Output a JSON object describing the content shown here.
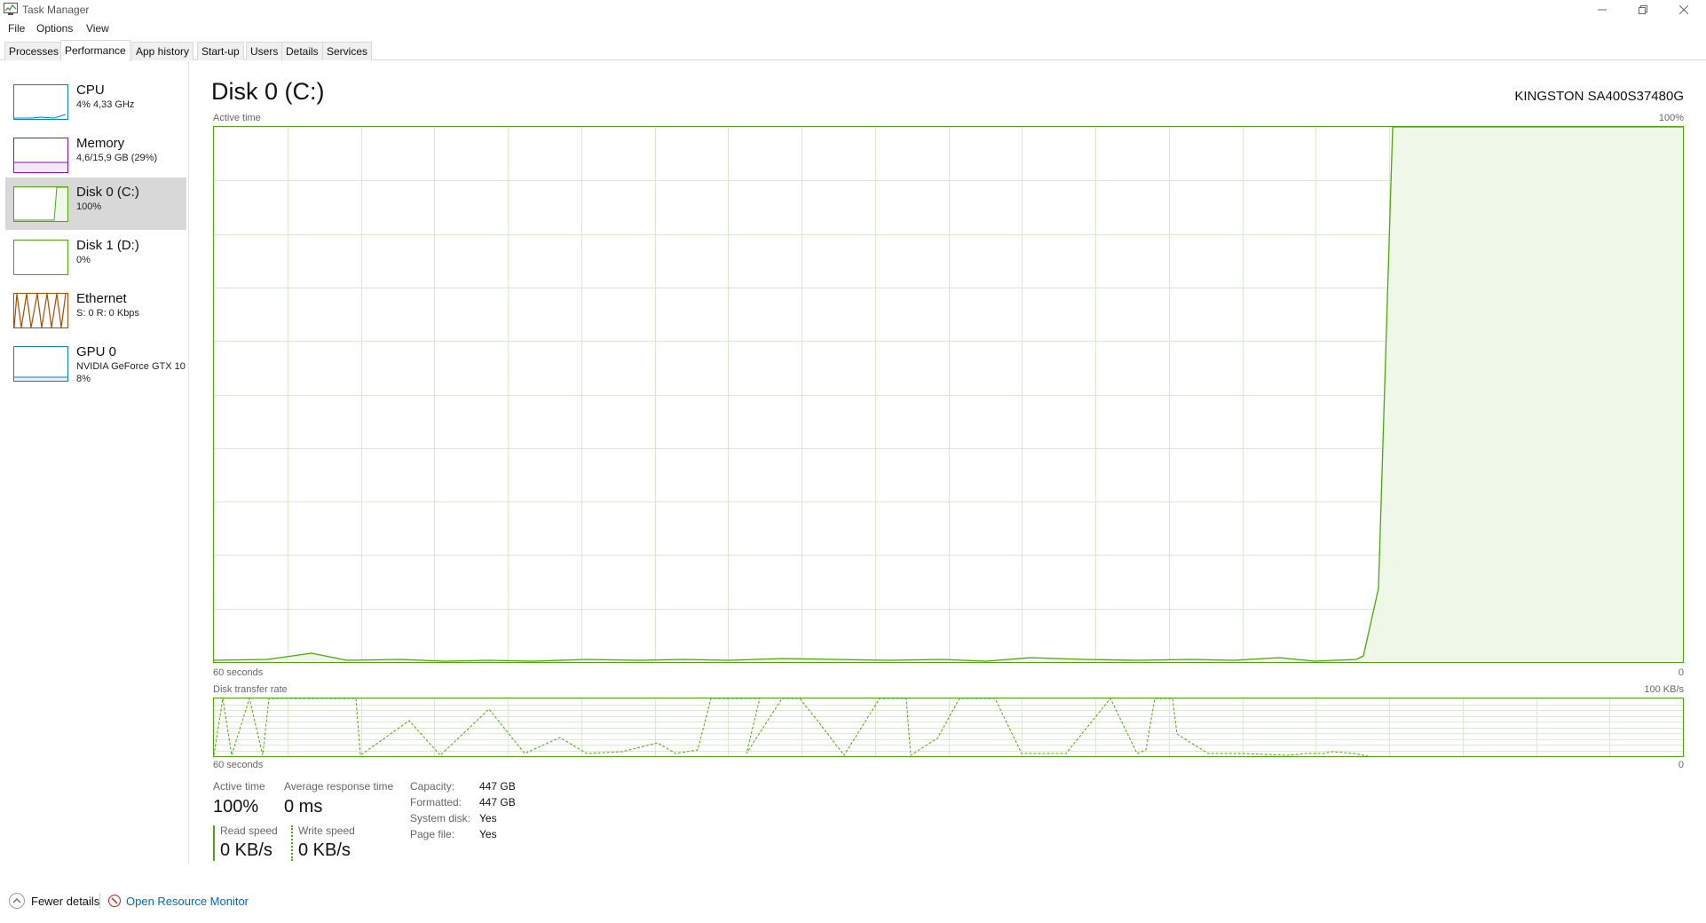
{
  "window": {
    "title": "Task Manager"
  },
  "menu": {
    "items": [
      "File",
      "Options",
      "View"
    ]
  },
  "tabs": [
    "Processes",
    "Performance",
    "App history",
    "Start-up",
    "Users",
    "Details",
    "Services"
  ],
  "active_tab": "Performance",
  "sidebar": {
    "items": [
      {
        "name": "CPU",
        "sub": "4% 4,33 GHz",
        "sub2": "",
        "color": "#117dbb"
      },
      {
        "name": "Memory",
        "sub": "4,6/15,9 GB (29%)",
        "sub2": "",
        "color": "#8b12ae"
      },
      {
        "name": "Disk 0 (C:)",
        "sub": "100%",
        "sub2": "",
        "color": "#4da60c"
      },
      {
        "name": "Disk 1 (D:)",
        "sub": "0%",
        "sub2": "",
        "color": "#4da60c"
      },
      {
        "name": "Ethernet",
        "sub": "S: 0 R: 0 Kbps",
        "sub2": "",
        "color": "#a74f01"
      },
      {
        "name": "GPU 0",
        "sub": "NVIDIA GeForce GTX 10",
        "sub2": "8%",
        "color": "#117dbb"
      }
    ],
    "selected_index": 2
  },
  "main": {
    "title": "Disk 0 (C:)",
    "device": "KINGSTON SA400S37480G",
    "active_chart": {
      "label": "Active time",
      "max_label": "100%",
      "time_label": "60 seconds",
      "min_label": "0"
    },
    "transfer_chart": {
      "label": "Disk transfer rate",
      "max_label": "100 KB/s",
      "time_label": "60 seconds",
      "min_label": "0"
    },
    "stats": {
      "active_time_label": "Active time",
      "active_time_value": "100%",
      "avg_response_label": "Average response time",
      "avg_response_value": "0 ms",
      "read_speed_label": "Read speed",
      "read_speed_value": "0 KB/s",
      "write_speed_label": "Write speed",
      "write_speed_value": "0 KB/s"
    },
    "info": [
      {
        "key": "Capacity:",
        "value": "447 GB"
      },
      {
        "key": "Formatted:",
        "value": "447 GB"
      },
      {
        "key": "System disk:",
        "value": "Yes"
      },
      {
        "key": "Page file:",
        "value": "Yes"
      }
    ]
  },
  "footer": {
    "fewer_details": "Fewer details",
    "resource_monitor": "Open Resource Monitor"
  },
  "colors": {
    "disk_green": "#4da60c",
    "disk_fill": "#eff7e8",
    "link_blue": "#0066cc"
  }
}
